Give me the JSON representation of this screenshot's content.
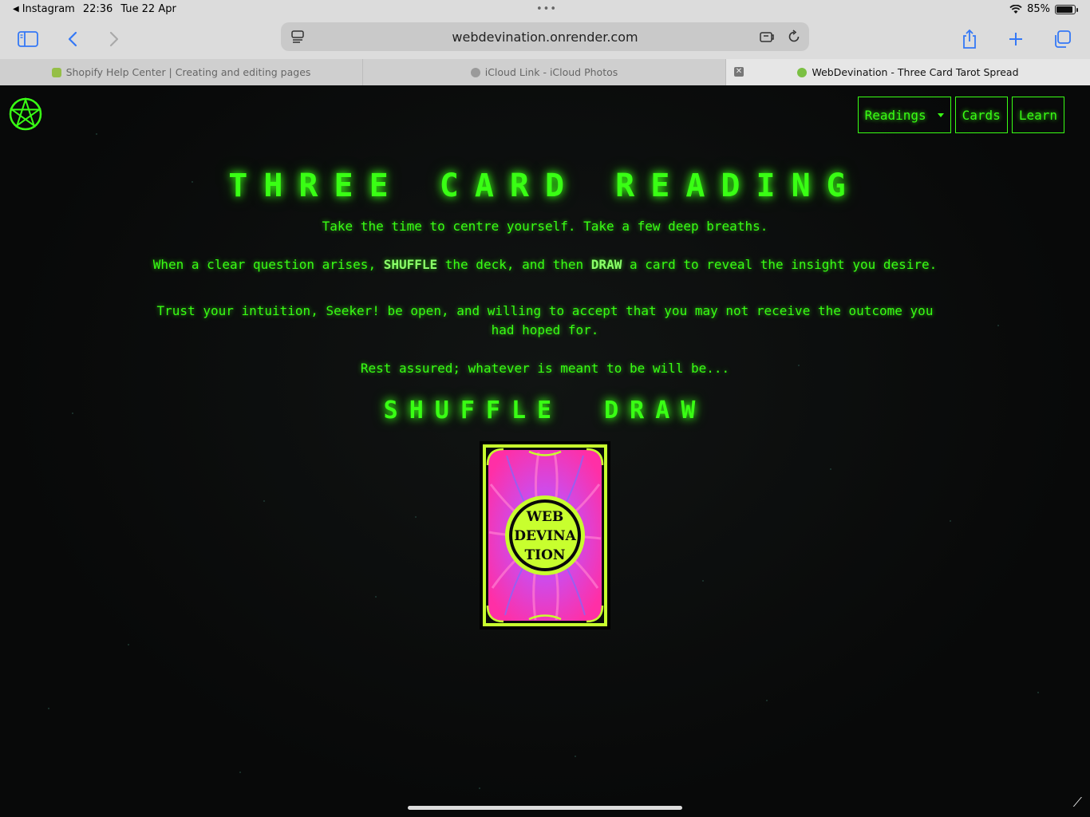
{
  "status_bar": {
    "back_app": "Instagram",
    "time": "22:36",
    "date": "Tue 22 Apr",
    "battery": "85%"
  },
  "toolbar": {
    "url": "webdevination.onrender.com"
  },
  "tabs": [
    {
      "title": "Shopify Help Center | Creating and editing pages",
      "favicon_color": "#95bf47"
    },
    {
      "title": "iCloud Link - iCloud Photos",
      "favicon_color": "#9a9a9a"
    },
    {
      "title": "WebDevination - Three Card Tarot Spread",
      "favicon_color": "#7bc043",
      "active": true
    }
  ],
  "site": {
    "accent_color": "#39ff14",
    "nav": {
      "readings": "Readings",
      "cards": "Cards",
      "learn": "Learn"
    },
    "title": "THREE CARD READING",
    "intro": "Take the time to centre yourself. Take a few deep breaths.",
    "instruction": {
      "part1": "When a clear question arises, ",
      "shuffle_word": "SHUFFLE",
      "part2": " the deck, and then ",
      "draw_word": "DRAW",
      "part3": " a card to reveal the insight you desire."
    },
    "trust": "Trust your intuition, Seeker! be open, and willing to accept that you may not receive the outcome you had hoped for.",
    "assurance": "Rest assured; whatever is meant to be will be...",
    "actions": {
      "shuffle": "SHUFFLE",
      "draw": "DRAW"
    },
    "card_back_text": [
      "WEB",
      "DEVINA",
      "TION"
    ]
  }
}
